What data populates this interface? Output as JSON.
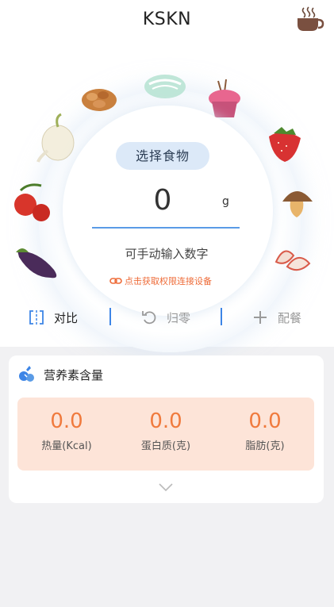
{
  "app": {
    "title": "KSKN"
  },
  "dial": {
    "select_label": "选择食物",
    "weight_value": "0",
    "weight_unit": "g",
    "manual_hint": "可手动输入数字",
    "connect_hint": "点击获取权限连接设备"
  },
  "actions": {
    "compare": "对比",
    "reset": "归零",
    "add_meal": "配餐"
  },
  "nutrition": {
    "title": "营养素含量",
    "items": [
      {
        "value": "0.0",
        "label": "热量(Kcal)"
      },
      {
        "value": "0.0",
        "label": "蛋白质(克)"
      },
      {
        "value": "0.0",
        "label": "脂肪(克)"
      }
    ]
  },
  "colors": {
    "accent": "#3d85e6",
    "orange": "#f07a3d",
    "panel": "#fde4d8",
    "select_bg": "#dce9f8"
  },
  "icons": [
    "coffee-cup-icon",
    "link-icon",
    "compare-icon",
    "reset-icon",
    "plus-icon",
    "nutrition-icon",
    "chevron-down-icon"
  ]
}
